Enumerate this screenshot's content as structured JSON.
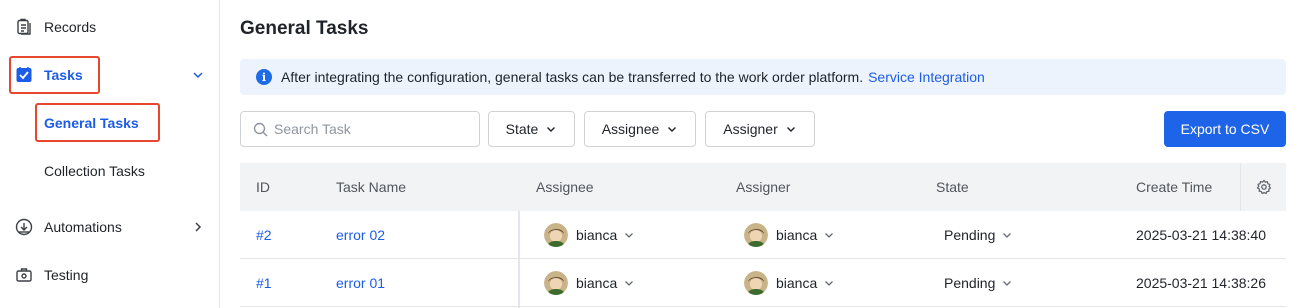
{
  "sidebar": {
    "records": "Records",
    "tasks": "Tasks",
    "general_tasks": "General Tasks",
    "collection_tasks": "Collection Tasks",
    "automations": "Automations",
    "testing": "Testing"
  },
  "page": {
    "title": "General Tasks"
  },
  "banner": {
    "text": "After integrating the configuration, general tasks can be transferred to the work order platform.",
    "link": "Service Integration"
  },
  "toolbar": {
    "search_placeholder": "Search Task",
    "filters": [
      "State",
      "Assignee",
      "Assigner"
    ],
    "export_label": "Export to CSV"
  },
  "table": {
    "columns": [
      "ID",
      "Task Name",
      "Assignee",
      "Assigner",
      "State",
      "Create Time"
    ],
    "rows": [
      {
        "id": "#2",
        "name": "error 02",
        "assignee": "bianca",
        "assigner": "bianca",
        "state": "Pending",
        "created": "2025-03-21 14:38:40"
      },
      {
        "id": "#1",
        "name": "error 01",
        "assignee": "bianca",
        "assigner": "bianca",
        "state": "Pending",
        "created": "2025-03-21 14:38:26"
      }
    ]
  },
  "colors": {
    "accent": "#1d5ce6",
    "highlight_box": "#e8462f",
    "banner_bg": "#edf3fd",
    "header_bg": "#f2f3f5"
  },
  "icons": {
    "records": "clipboard-icon",
    "tasks": "checkbox-icon",
    "automations": "download-circle-icon",
    "testing": "briefcase-icon",
    "settings": "gear-icon",
    "info": "info-icon",
    "search": "search-icon"
  }
}
